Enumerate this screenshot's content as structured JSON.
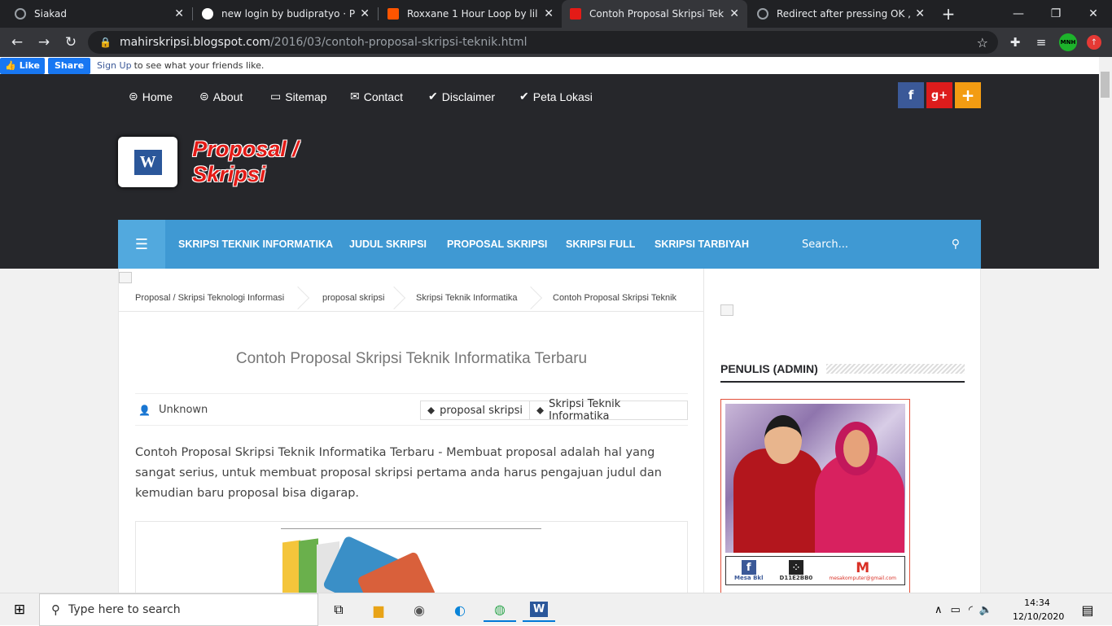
{
  "browser": {
    "tabs": [
      {
        "title": "Siakad",
        "favicon_color": "#9aa0a6"
      },
      {
        "title": "new login by budipratyo · Pull",
        "favicon_color": "#ffffff"
      },
      {
        "title": "Roxxane 1 Hour Loop by lil",
        "favicon_color": "#ff5500"
      },
      {
        "title": "Contoh Proposal Skripsi Teknik",
        "favicon_color": "#e41b17",
        "active": true
      },
      {
        "title": "Redirect after pressing OK , in",
        "favicon_color": "#9aa0a6"
      }
    ],
    "new_tab_label": "+",
    "url_host": "mahirskripsi.blogspot.com",
    "url_path": "/2016/03/contoh-proposal-skripsi-teknik.html",
    "profile_badge": "MNH"
  },
  "facebook": {
    "like_label": "Like",
    "share_label": "Share",
    "signup_label": "Sign Up",
    "signup_text": "to see what your friends like."
  },
  "topnav": {
    "items": [
      {
        "label": "Home",
        "icon": "globe-icon"
      },
      {
        "label": "About",
        "icon": "globe-icon"
      },
      {
        "label": "Sitemap",
        "icon": "folder-icon"
      },
      {
        "label": "Contact",
        "icon": "envelope-icon"
      },
      {
        "label": "Disclaimer",
        "icon": "check-circle-icon"
      },
      {
        "label": "Peta Lokasi",
        "icon": "check-circle-icon"
      }
    ],
    "social": [
      {
        "label": "f",
        "color": "#3b5998",
        "icon": "facebook-icon"
      },
      {
        "label": "g+",
        "color": "#dd1c1c",
        "icon": "google-plus-icon"
      },
      {
        "label": "+",
        "color": "#f39c12",
        "icon": "plus-icon"
      }
    ]
  },
  "header": {
    "logo_text": "Proposal / Skripsi",
    "logo_icon_letter": "W"
  },
  "mainnav": {
    "items": [
      "SKRIPSI TEKNIK INFORMATIKA",
      "JUDUL SKRIPSI",
      "PROPOSAL SKRIPSI",
      "SKRIPSI FULL",
      "SKRIPSI TARBIYAH"
    ],
    "search_placeholder": "Search..."
  },
  "post": {
    "breadcrumb": [
      "Proposal / Skripsi Teknologi Informasi",
      "proposal skripsi",
      "Skripsi Teknik Informatika",
      "Contoh Proposal Skripsi Teknik"
    ],
    "title": "Contoh Proposal Skripsi Teknik Informatika Terbaru",
    "author": "Unknown",
    "tags": [
      "proposal skripsi",
      "Skripsi Teknik Informatika"
    ],
    "body": "Contoh Proposal Skripsi Teknik Informatika Terbaru - Membuat proposal adalah hal yang sangat serius, untuk membuat proposal skripsi pertama anda harus pengajuan judul dan kemudian baru proposal bisa digarap."
  },
  "sidebar": {
    "widget_title": "PENULIS (ADMIN)",
    "contacts": [
      {
        "label": "Mesa Bkl",
        "icon": "facebook-icon"
      },
      {
        "label": "D11E2BB0",
        "icon": "blackberry-icon"
      },
      {
        "label": "mesakomputer@gmail.com",
        "icon": "gmail-icon"
      }
    ]
  },
  "taskbar": {
    "search_placeholder": "Type here to search",
    "time": "14:34",
    "date": "12/10/2020"
  }
}
